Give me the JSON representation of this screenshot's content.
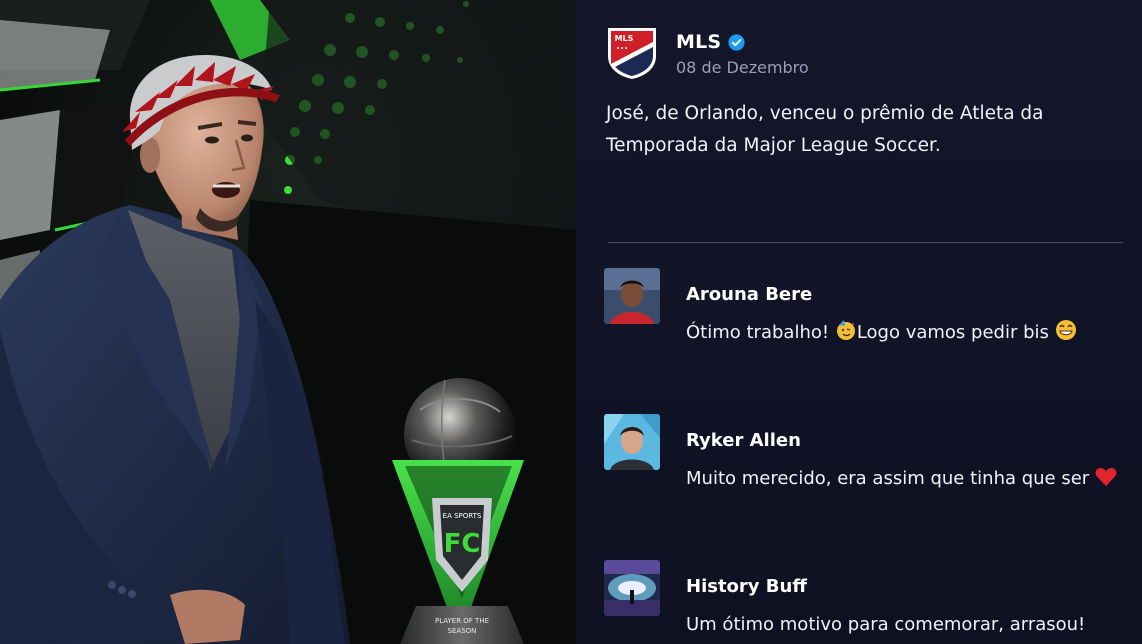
{
  "post": {
    "author": "MLS",
    "verified_icon": "verified-check-icon",
    "date": "08 de Dezembro",
    "text": "José, de Orlando, venceu o prêmio de Atleta da Temporada da Major League Soccer.",
    "logo_text": "MLS",
    "brand_colors": {
      "mls_red": "#d11f2a",
      "mls_navy": "#1b2a55",
      "verified_blue": "#1d9bf0"
    }
  },
  "scene": {
    "trophy_top_text": "EA SPORTS",
    "trophy_plate_text": "PLAYER OF THE SEASON",
    "accent_green": "#3ddc3a"
  },
  "comments": [
    {
      "name": "Arouna Bere",
      "text_before": "Ótimo trabalho! ",
      "emoji_mid": "partying-face-emoji",
      "text_after": "Logo vamos pedir bis ",
      "emoji_end": "grinning-face-emoji"
    },
    {
      "name": "Ryker Allen",
      "text": "Muito merecido, era assim que tinha que ser ",
      "emoji_end": "red-heart-emoji"
    },
    {
      "name": "History Buff",
      "text": "Um ótimo motivo para comemorar, arrasou!"
    }
  ]
}
